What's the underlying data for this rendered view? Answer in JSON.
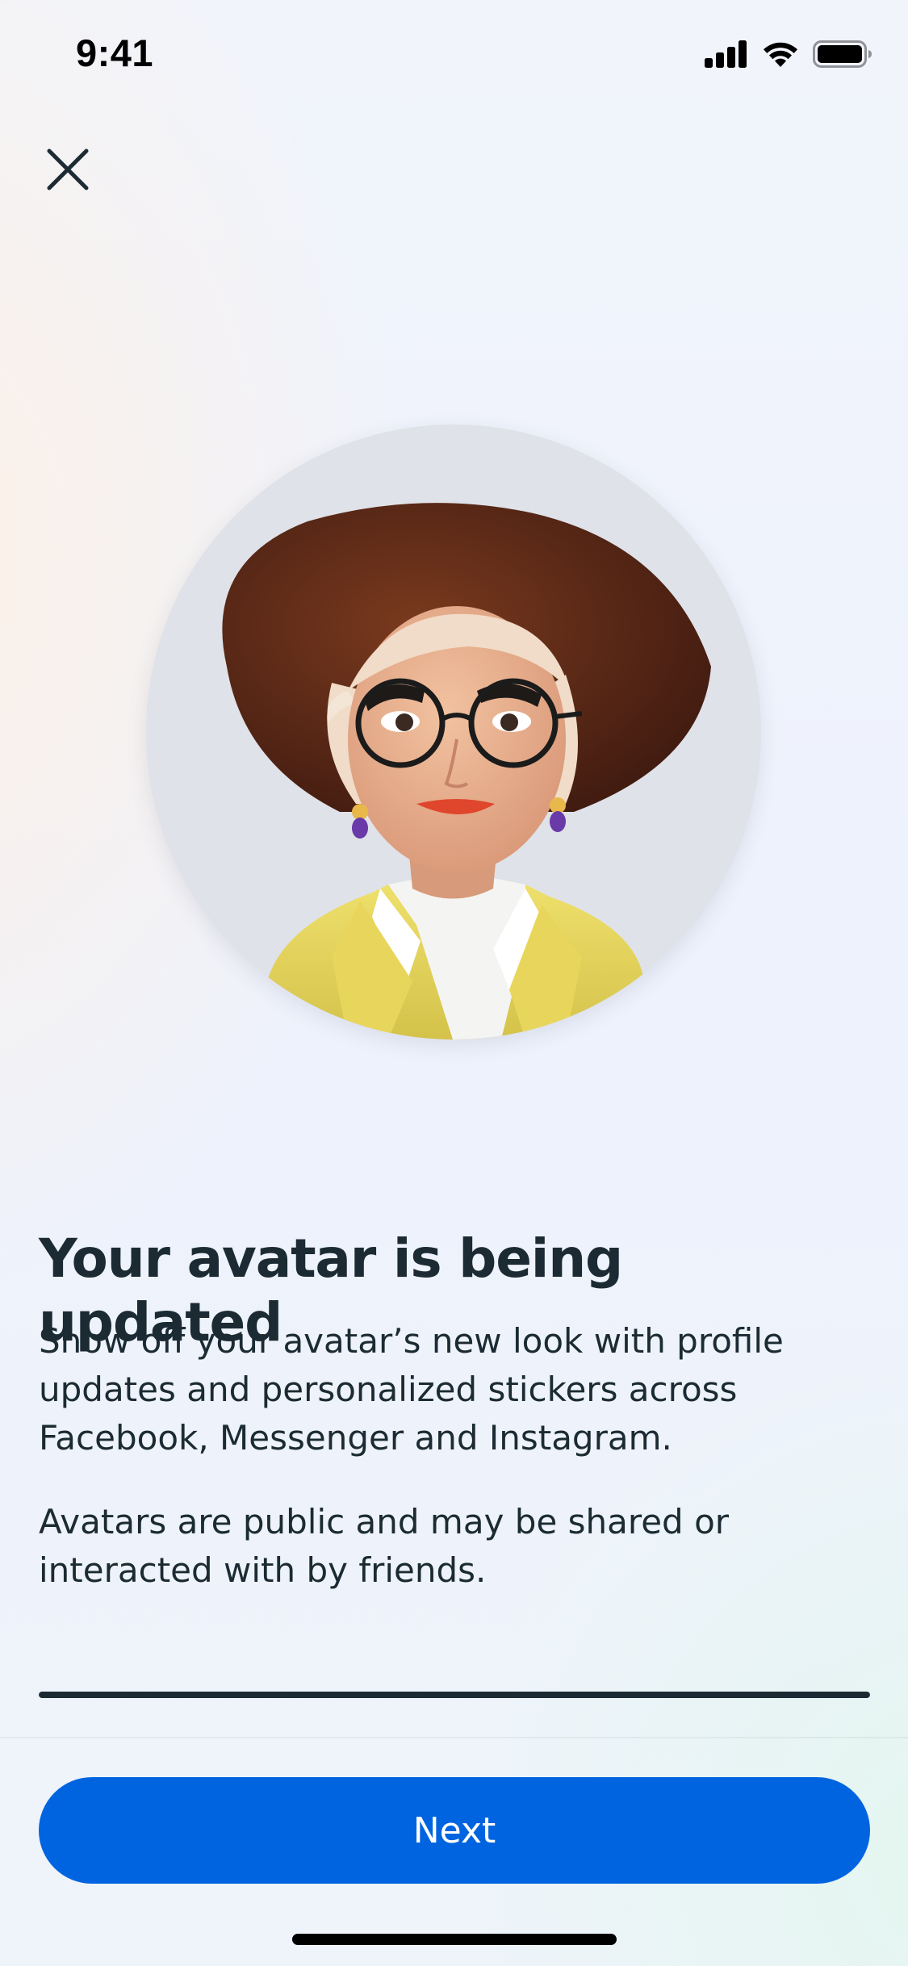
{
  "status_bar": {
    "time": "9:41",
    "icons": [
      "cellular-signal-icon",
      "wifi-icon",
      "battery-icon"
    ]
  },
  "close": {
    "icon": "close-icon"
  },
  "avatar": {
    "image": "avatar-illustration"
  },
  "content": {
    "title": "Your avatar is being updated",
    "paragraph_1": "Show off your avatar’s new look with profile updates and personalized stickers across Facebook, Messenger and Instagram.",
    "paragraph_2": "Avatars are public and may be shared or interacted with by friends."
  },
  "progress": {
    "value": 1.0
  },
  "actions": {
    "next_label": "Next"
  },
  "colors": {
    "primary": "#0064e0",
    "text": "#1c2b33",
    "avatar_bg": "#dfe2e8"
  }
}
